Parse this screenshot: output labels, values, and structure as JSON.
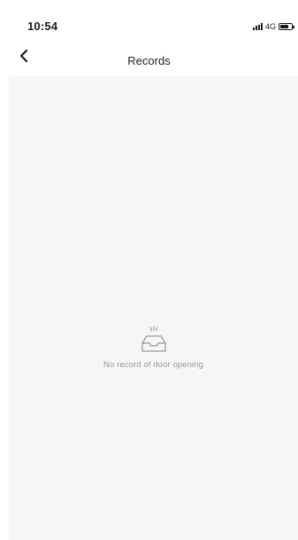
{
  "status_bar": {
    "time": "10:54",
    "network": "4G"
  },
  "header": {
    "title": "Records"
  },
  "empty_state": {
    "message": "No record of door opening"
  },
  "icons": {
    "back": "chevron-left-icon",
    "empty": "empty-inbox-icon"
  },
  "colors": {
    "background": "#ffffff",
    "content_background": "#f6f6f6",
    "text": "#222222",
    "muted_text": "#9a9a9a"
  }
}
